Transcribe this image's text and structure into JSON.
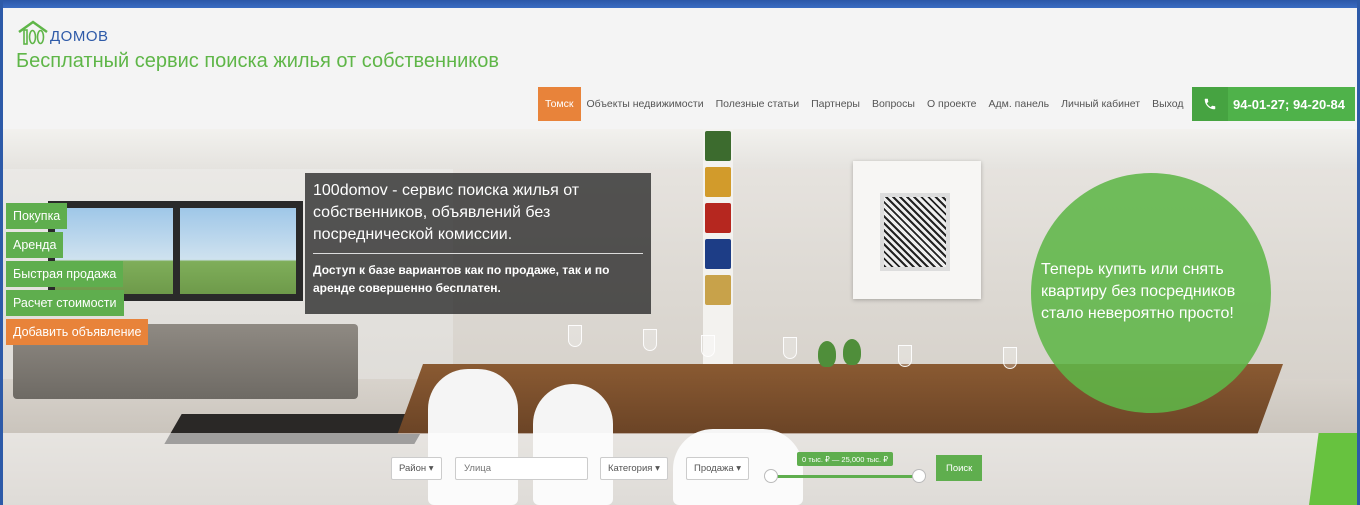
{
  "logo": {
    "number": "100",
    "text": "ДОМОВ"
  },
  "tagline": "Бесплатный сервис поиска жилья от собственников",
  "nav": {
    "items": [
      {
        "label": "Томск",
        "active": true
      },
      {
        "label": "Объекты недвижимости"
      },
      {
        "label": "Полезные статьи"
      },
      {
        "label": "Партнеры"
      },
      {
        "label": "Вопросы"
      },
      {
        "label": "О проекте"
      },
      {
        "label": "Адм. панель"
      },
      {
        "label": "Личный кабинет"
      },
      {
        "label": "Выход"
      }
    ],
    "phone": "94-01-27; 94-20-84"
  },
  "side_menu": [
    {
      "label": "Покупка"
    },
    {
      "label": "Аренда"
    },
    {
      "label": "Быстрая продажа"
    },
    {
      "label": "Расчет стоимости"
    },
    {
      "label": "Добавить объявление"
    }
  ],
  "info_box": {
    "title": "100domov - сервис поиска жилья от собственников, объявлений без посреднической комиссии.",
    "subtitle": "Доступ к базе вариантов как по продаже, так и по аренде совершенно бесплатен."
  },
  "promo_circle": "Теперь купить или снять квартиру без посредников стало невероятно просто!",
  "search": {
    "district": "Район",
    "street_placeholder": "Улица",
    "category": "Категория",
    "deal": "Продажа",
    "price_range": "0 тыс. ₽ — 25,000 тыс. ₽",
    "price_min": 0,
    "price_max": 25000,
    "button": "Поиск"
  },
  "colors": {
    "green": "#5fb648",
    "orange": "#e8833a",
    "blue": "#2e5aa8"
  }
}
